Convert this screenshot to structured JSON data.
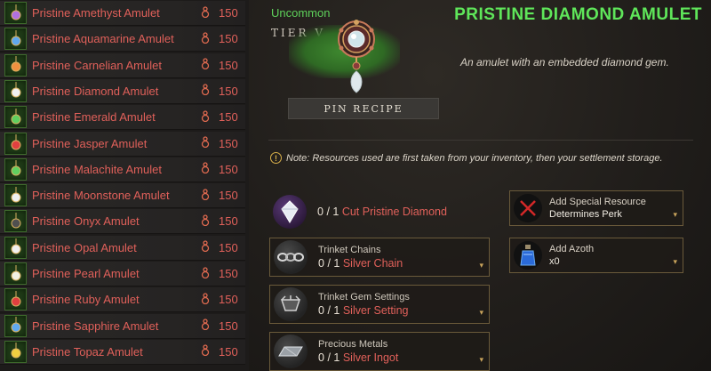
{
  "recipes": [
    {
      "name": "Pristine Amethyst Amulet",
      "cost": "150",
      "gem": "purple-gem-icon"
    },
    {
      "name": "Pristine Aquamarine Amulet",
      "cost": "150",
      "gem": "blue-gem-icon"
    },
    {
      "name": "Pristine Carnelian Amulet",
      "cost": "150",
      "gem": "orange-gem-icon"
    },
    {
      "name": "Pristine Diamond Amulet",
      "cost": "150",
      "gem": "white-gem-icon"
    },
    {
      "name": "Pristine Emerald Amulet",
      "cost": "150",
      "gem": "green-gem-icon"
    },
    {
      "name": "Pristine Jasper Amulet",
      "cost": "150",
      "gem": "red-gem-icon"
    },
    {
      "name": "Pristine Malachite Amulet",
      "cost": "150",
      "gem": "green-gem-icon"
    },
    {
      "name": "Pristine Moonstone Amulet",
      "cost": "150",
      "gem": "white-gem-icon"
    },
    {
      "name": "Pristine Onyx Amulet",
      "cost": "150",
      "gem": "black-gem-icon"
    },
    {
      "name": "Pristine Opal Amulet",
      "cost": "150",
      "gem": "white-gem-icon"
    },
    {
      "name": "Pristine Pearl Amulet",
      "cost": "150",
      "gem": "pearl-gem-icon"
    },
    {
      "name": "Pristine Ruby Amulet",
      "cost": "150",
      "gem": "red-gem-icon"
    },
    {
      "name": "Pristine Sapphire Amulet",
      "cost": "150",
      "gem": "blue-gem-icon"
    },
    {
      "name": "Pristine Topaz Amulet",
      "cost": "150",
      "gem": "yellow-gem-icon"
    }
  ],
  "item": {
    "rarity": "Uncommon",
    "tier": "TIER V",
    "title": "PRISTINE DIAMOND AMULET",
    "description": "An amulet with an embedded diamond gem.",
    "pin_label": "PIN RECIPE"
  },
  "note": "Note: Resources used are first taken from your inventory, then your settlement storage.",
  "ingredients": [
    {
      "category": "",
      "have": "0",
      "need": "1",
      "name": "Cut Pristine Diamond",
      "icon": "diamond-icon"
    },
    {
      "category": "Trinket Chains",
      "have": "0",
      "need": "1",
      "name": "Silver Chain",
      "icon": "chain-icon"
    },
    {
      "category": "Trinket Gem Settings",
      "have": "0",
      "need": "1",
      "name": "Silver Setting",
      "icon": "setting-icon"
    },
    {
      "category": "Precious Metals",
      "have": "0",
      "need": "1",
      "name": "Silver Ingot",
      "icon": "ingot-icon"
    }
  ],
  "special": {
    "title": "Add Special Resource",
    "sub": "Determines Perk"
  },
  "azoth": {
    "title": "Add Azoth",
    "amount": "x0"
  },
  "colors": {
    "recipe_text": "#e0605a",
    "title_green": "#5fe65a",
    "border_gold": "#6a5a3a"
  }
}
